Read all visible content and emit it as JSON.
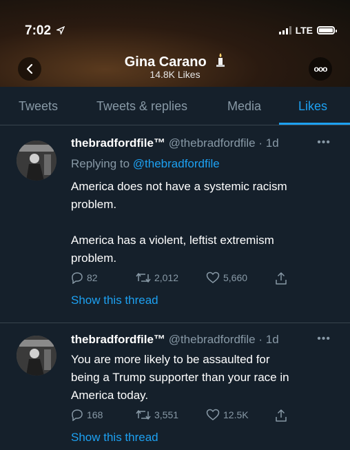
{
  "status_bar": {
    "time": "7:02",
    "carrier": "LTE"
  },
  "profile": {
    "name": "Gina Carano",
    "likes": "14.8K Likes"
  },
  "tabs": [
    {
      "label": "Tweets",
      "active": false
    },
    {
      "label": "Tweets & replies",
      "active": false
    },
    {
      "label": "Media",
      "active": false
    },
    {
      "label": "Likes",
      "active": true
    }
  ],
  "tweets": [
    {
      "name": "thebradfordfile™",
      "handle": "@thebradfordfile",
      "time": "· 1d",
      "replying_prefix": "Replying to ",
      "replying_handle": "@thebradfordfile",
      "lines": [
        "America does not have a systemic racism",
        "problem.",
        "",
        "America has a violent, leftist extremism",
        "problem."
      ],
      "replies": "82",
      "retweets": "2,012",
      "likes": "5,660",
      "show_thread": "Show this thread"
    },
    {
      "name": "thebradfordfile™",
      "handle": "@thebradfordfile",
      "time": "· 1d",
      "lines": [
        "You are more likely to be assaulted for",
        "being a Trump supporter than your race in",
        "America today."
      ],
      "replies": "168",
      "retweets": "3,551",
      "likes": "12.5K",
      "show_thread": "Show this thread"
    }
  ],
  "colors": {
    "background": "#15202b",
    "accent": "#1da1f2",
    "muted": "#8899a6"
  }
}
